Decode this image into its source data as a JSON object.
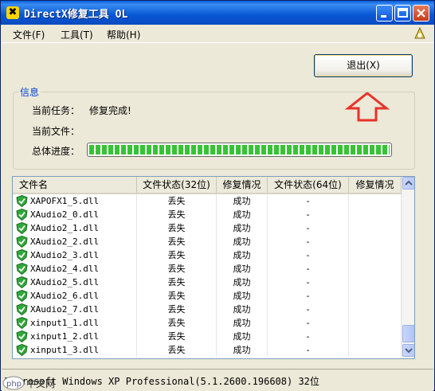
{
  "window": {
    "title": "DirectX修复工具 OL",
    "icon": "directx-icon"
  },
  "menu": [
    {
      "label": "文件(F)"
    },
    {
      "label": "工具(T)"
    },
    {
      "label": "帮助(H)"
    }
  ],
  "exit_button": {
    "label": "退出(X)"
  },
  "info": {
    "group_title": "信息",
    "task_label": "当前任务：",
    "task_value": "修复完成!",
    "file_label": "当前文件：",
    "file_value": "",
    "progress_label": "总体进度：",
    "progress_fraction": 1.0
  },
  "table": {
    "headers": [
      "文件名",
      "文件状态(32位)",
      "修复情况",
      "文件状态(64位)",
      "修复情况"
    ],
    "rows": [
      [
        "XAPOFX1_5.dll",
        "丢失",
        "成功",
        "-",
        ""
      ],
      [
        "XAudio2_0.dll",
        "丢失",
        "成功",
        "-",
        ""
      ],
      [
        "XAudio2_1.dll",
        "丢失",
        "成功",
        "-",
        ""
      ],
      [
        "XAudio2_2.dll",
        "丢失",
        "成功",
        "-",
        ""
      ],
      [
        "XAudio2_3.dll",
        "丢失",
        "成功",
        "-",
        ""
      ],
      [
        "XAudio2_4.dll",
        "丢失",
        "成功",
        "-",
        ""
      ],
      [
        "XAudio2_5.dll",
        "丢失",
        "成功",
        "-",
        ""
      ],
      [
        "XAudio2_6.dll",
        "丢失",
        "成功",
        "-",
        ""
      ],
      [
        "XAudio2_7.dll",
        "丢失",
        "成功",
        "-",
        ""
      ],
      [
        "xinput1_1.dll",
        "丢失",
        "成功",
        "-",
        ""
      ],
      [
        "xinput1_2.dll",
        "丢失",
        "成功",
        "-",
        ""
      ],
      [
        "xinput1_3.dll",
        "丢失",
        "成功",
        "-",
        ""
      ]
    ],
    "row_icon": "green-shield-check-icon"
  },
  "status": {
    "text": "Microsoft Windows XP Professional(5.1.2600.196608) 32位"
  },
  "watermark": {
    "text": "php中文网"
  },
  "colors": {
    "accent_arrow": "#e8322a",
    "progress": "#37c335",
    "group_title": "#0046d5"
  }
}
